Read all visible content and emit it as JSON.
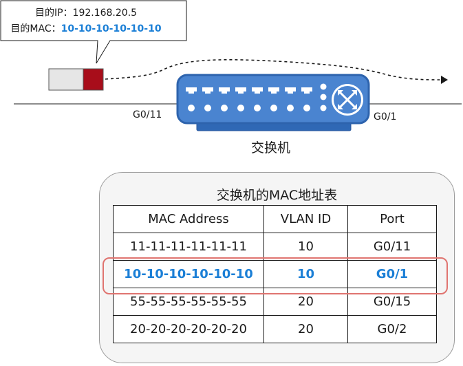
{
  "callout": {
    "dest_ip_label": "目的IP：",
    "dest_ip_value": "192.168.20.5",
    "dest_mac_label": "目的MAC：",
    "dest_mac_value": "10-10-10-10-10-10"
  },
  "network": {
    "left_port": "G0/11",
    "right_port": "G0/1",
    "switch_label": "交换机"
  },
  "mac_table": {
    "title": "交换机的MAC地址表",
    "headers": [
      "MAC Address",
      "VLAN ID",
      "Port"
    ],
    "rows": [
      [
        "11-11-11-11-11-11",
        "10",
        "G0/11"
      ],
      [
        "10-10-10-10-10-10",
        "10",
        "G0/1"
      ],
      [
        "55-55-55-55-55-55",
        "20",
        "G0/15"
      ],
      [
        "20-20-20-20-20-20",
        "20",
        "G0/2"
      ]
    ],
    "highlighted_row": 1
  },
  "colors": {
    "switch_blue": "#3a75c4",
    "highlight_text": "#1b7fd6",
    "highlight_border": "#e07470",
    "frame_red": "#a80d1a"
  }
}
